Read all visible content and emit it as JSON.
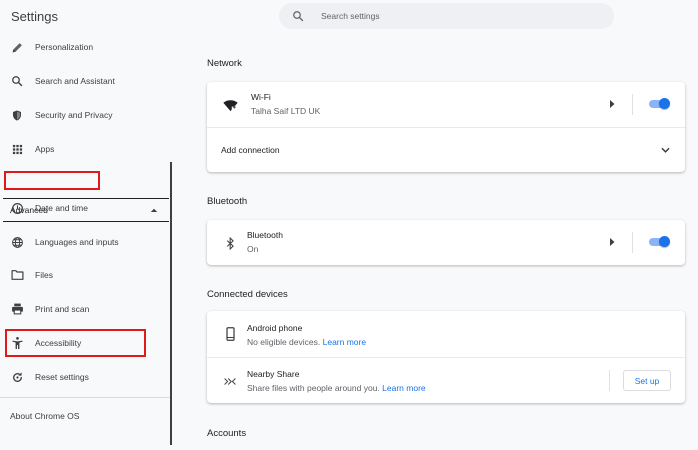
{
  "app_title": "Settings",
  "search": {
    "placeholder": "Search settings"
  },
  "sidebar": {
    "items": [
      {
        "label": "Personalization",
        "icon": "pencil-icon"
      },
      {
        "label": "Search and Assistant",
        "icon": "search-icon"
      },
      {
        "label": "Security and Privacy",
        "icon": "shield-icon"
      },
      {
        "label": "Apps",
        "icon": "apps-grid-icon"
      }
    ],
    "advanced": {
      "label": "Advanced",
      "expanded": true
    },
    "advanced_items": [
      {
        "label": "Date and time",
        "icon": "clock-icon"
      },
      {
        "label": "Languages and inputs",
        "icon": "globe-icon"
      },
      {
        "label": "Files",
        "icon": "folder-icon"
      },
      {
        "label": "Print and scan",
        "icon": "printer-icon"
      },
      {
        "label": "Accessibility",
        "icon": "accessibility-icon"
      },
      {
        "label": "Reset settings",
        "icon": "reset-icon"
      }
    ],
    "about": "About Chrome OS"
  },
  "main": {
    "network": {
      "heading": "Network",
      "wifi": {
        "title": "Wi-Fi",
        "subtitle": "Talha Saif LTD UK",
        "enabled": true
      },
      "add_connection": "Add connection"
    },
    "bluetooth": {
      "heading": "Bluetooth",
      "item": {
        "title": "Bluetooth",
        "subtitle": "On",
        "enabled": true
      }
    },
    "connected_devices": {
      "heading": "Connected devices",
      "android": {
        "title": "Android phone",
        "subtitle": "No eligible devices.",
        "link": "Learn more"
      },
      "nearby": {
        "title": "Nearby Share",
        "subtitle": "Share files with people around you.",
        "link": "Learn more",
        "button": "Set up"
      }
    },
    "accounts": {
      "heading": "Accounts"
    }
  },
  "colors": {
    "accent": "#1a73e8",
    "highlight": "#e01919",
    "toggle_track": "#8ab4f8"
  }
}
